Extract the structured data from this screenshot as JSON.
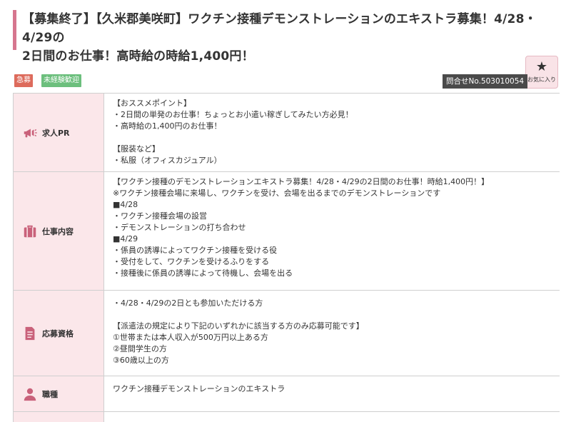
{
  "title": {
    "line1": "【募集終了】【久米郡美咲町】ワクチン接種デモンストレーションのエキストラ募集！4/28・4/29の",
    "line2": "2日間のお仕事！高時給の時給1,400円！"
  },
  "badges": {
    "urgent": "急募",
    "beginner": "未経験歓迎"
  },
  "inquiry": "問合せNo.503010054",
  "favorite": {
    "label": "お気に入り",
    "icon": "star-icon"
  },
  "colors": {
    "accent": "#d6768f",
    "header_bg": "#fbe7ea",
    "urgent": "#dd6b5c",
    "beginner": "#6cbf7d",
    "dark": "#4a4a4a"
  },
  "rows": [
    {
      "label": "求人PR",
      "icon": "megaphone-icon",
      "lines": [
        "【おススメポイント】",
        "・2日間の単発のお仕事！ちょっとお小遣い稼ぎしてみたい方必見！",
        "・高時給の1,400円のお仕事！",
        "",
        "【服装など】",
        "・私服（オフィスカジュアル）"
      ]
    },
    {
      "label": "仕事内容",
      "icon": "briefcase-icon",
      "lines": [
        "【ワクチン接種のデモンストレーションエキストラ募集！4/28・4/29の2日間のお仕事！時給1,400円！】",
        "※ワクチン接種会場に来場し、ワクチンを受け、会場を出るまでのデモンストレーションです",
        "■4/28",
        "・ワクチン接種会場の設営",
        "・デモンストレーションの打ち合わせ",
        "■4/29",
        "・係員の誘導によってワクチン接種を受ける役",
        "・受付をして、ワクチンを受けるふりをする",
        "・接種後に係員の誘導によって待機し、会場を出る"
      ]
    },
    {
      "label": "応募資格",
      "icon": "document-icon",
      "lines": [
        "・4/28・4/29の2日とも参加いただける方",
        "",
        "【派遣法の規定により下記のいずれかに該当する方のみ応募可能です】",
        "①世帯または本人収入が500万円以上ある方",
        "②昼間学生の方",
        "③60歳以上の方"
      ]
    },
    {
      "label": "職種",
      "icon": "person-icon",
      "lines": [
        "ワクチン接種デモンストレーションのエキストラ"
      ]
    }
  ]
}
